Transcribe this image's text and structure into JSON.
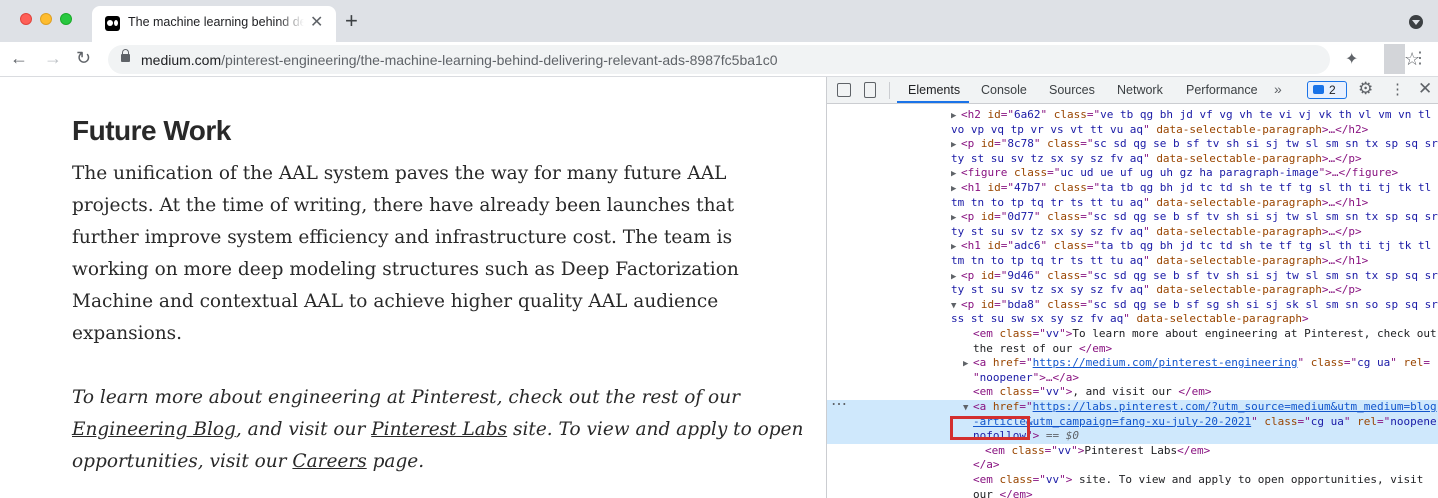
{
  "browser": {
    "tab_title": "The machine learning behind delivering relevant ads",
    "tab_close": "✕",
    "new_tab": "+",
    "url_domain": "medium.com",
    "url_path": "/pinterest-engineering/the-machine-learning-behind-delivering-relevant-ads-8987fc5ba1c0",
    "icons": [
      "back-icon",
      "forward-icon",
      "reload-icon",
      "lock-icon",
      "star-icon",
      "extensions-icon",
      "menu-icon"
    ]
  },
  "article": {
    "heading": "Future Work",
    "paragraph_lines": [
      "The unification of the AAL system paves the way for many future AAL",
      "projects. At the time of writing, there have already been launches that",
      "further improve system efficiency and infrastructure cost. The team is",
      "working on more deep modeling structures such as Deep Factorization",
      "Machine and contextual AAL to achieve higher quality AAL audience",
      "expansions."
    ],
    "italic": {
      "part1": "To learn more about engineering at Pinterest, check out the rest of our",
      "link1": "Engineering Blog",
      "part2": ", and visit our ",
      "link2": "Pinterest Labs",
      "part3": " site. To view and apply to open",
      "part4": "opportunities, visit our ",
      "link3": "Careers",
      "part5": " page."
    }
  },
  "devtools": {
    "tabs": [
      "Elements",
      "Console",
      "Sources",
      "Network",
      "Performance"
    ],
    "active_tab": "Elements",
    "more": "»",
    "badge_count": "2",
    "accent": "#1a73e8",
    "lines": [
      {
        "indent": 1,
        "tri": "▶",
        "parts": [
          [
            "tag",
            "<h2 "
          ],
          [
            "attr",
            "id"
          ],
          [
            "tag",
            "=\""
          ],
          [
            "val",
            "6a62"
          ],
          [
            "tag",
            "\" "
          ],
          [
            "attr",
            "class"
          ],
          [
            "tag",
            "=\""
          ],
          [
            "val",
            "ve tb qg bh jd vf vg vh te vi vj vk th vl vm vn tl"
          ]
        ]
      },
      {
        "indent": 0,
        "tri": "",
        "parts": [
          [
            "val",
            "vo vp vq tp vr vs vt tt vu aq"
          ],
          [
            "tag",
            "\" "
          ],
          [
            "attr",
            "data-selectable-paragraph"
          ],
          [
            "tag",
            ">…</h2>"
          ]
        ]
      },
      {
        "indent": 1,
        "tri": "▶",
        "parts": [
          [
            "tag",
            "<p "
          ],
          [
            "attr",
            "id"
          ],
          [
            "tag",
            "=\""
          ],
          [
            "val",
            "8c78"
          ],
          [
            "tag",
            "\" "
          ],
          [
            "attr",
            "class"
          ],
          [
            "tag",
            "=\""
          ],
          [
            "val",
            "sc sd qg se b sf tv sh si sj tw sl sm sn tx sp sq sr"
          ]
        ]
      },
      {
        "indent": 0,
        "tri": "",
        "parts": [
          [
            "val",
            "ty st su sv tz sx sy sz fv aq"
          ],
          [
            "tag",
            "\" "
          ],
          [
            "attr",
            "data-selectable-paragraph"
          ],
          [
            "tag",
            ">…</p>"
          ]
        ]
      },
      {
        "indent": 1,
        "tri": "▶",
        "parts": [
          [
            "tag",
            "<figure "
          ],
          [
            "attr",
            "class"
          ],
          [
            "tag",
            "=\""
          ],
          [
            "val",
            "uc ud ue uf ug uh gz ha paragraph-image"
          ],
          [
            "tag",
            "\">…</figure>"
          ]
        ]
      },
      {
        "indent": 1,
        "tri": "▶",
        "parts": [
          [
            "tag",
            "<h1 "
          ],
          [
            "attr",
            "id"
          ],
          [
            "tag",
            "=\""
          ],
          [
            "val",
            "47b7"
          ],
          [
            "tag",
            "\" "
          ],
          [
            "attr",
            "class"
          ],
          [
            "tag",
            "=\""
          ],
          [
            "val",
            "ta tb qg bh jd tc td sh te tf tg sl th ti tj tk tl"
          ]
        ]
      },
      {
        "indent": 0,
        "tri": "",
        "parts": [
          [
            "val",
            "tm tn to tp tq tr ts tt tu aq"
          ],
          [
            "tag",
            "\" "
          ],
          [
            "attr",
            "data-selectable-paragraph"
          ],
          [
            "tag",
            ">…</h1>"
          ]
        ]
      },
      {
        "indent": 1,
        "tri": "▶",
        "parts": [
          [
            "tag",
            "<p "
          ],
          [
            "attr",
            "id"
          ],
          [
            "tag",
            "=\""
          ],
          [
            "val",
            "0d77"
          ],
          [
            "tag",
            "\" "
          ],
          [
            "attr",
            "class"
          ],
          [
            "tag",
            "=\""
          ],
          [
            "val",
            "sc sd qg se b sf tv sh si sj tw sl sm sn tx sp sq sr"
          ]
        ]
      },
      {
        "indent": 0,
        "tri": "",
        "parts": [
          [
            "val",
            "ty st su sv tz sx sy sz fv aq"
          ],
          [
            "tag",
            "\" "
          ],
          [
            "attr",
            "data-selectable-paragraph"
          ],
          [
            "tag",
            ">…</p>"
          ]
        ]
      },
      {
        "indent": 1,
        "tri": "▶",
        "parts": [
          [
            "tag",
            "<h1 "
          ],
          [
            "attr",
            "id"
          ],
          [
            "tag",
            "=\""
          ],
          [
            "val",
            "adc6"
          ],
          [
            "tag",
            "\" "
          ],
          [
            "attr",
            "class"
          ],
          [
            "tag",
            "=\""
          ],
          [
            "val",
            "ta tb qg bh jd tc td sh te tf tg sl th ti tj tk tl"
          ]
        ]
      },
      {
        "indent": 0,
        "tri": "",
        "parts": [
          [
            "val",
            "tm tn to tp tq tr ts tt tu aq"
          ],
          [
            "tag",
            "\" "
          ],
          [
            "attr",
            "data-selectable-paragraph"
          ],
          [
            "tag",
            ">…</h1>"
          ]
        ]
      },
      {
        "indent": 1,
        "tri": "▶",
        "parts": [
          [
            "tag",
            "<p "
          ],
          [
            "attr",
            "id"
          ],
          [
            "tag",
            "=\""
          ],
          [
            "val",
            "9d46"
          ],
          [
            "tag",
            "\" "
          ],
          [
            "attr",
            "class"
          ],
          [
            "tag",
            "=\""
          ],
          [
            "val",
            "sc sd qg se b sf tv sh si sj tw sl sm sn tx sp sq sr"
          ]
        ]
      },
      {
        "indent": 0,
        "tri": "",
        "parts": [
          [
            "val",
            "ty st su sv tz sx sy sz fv aq"
          ],
          [
            "tag",
            "\" "
          ],
          [
            "attr",
            "data-selectable-paragraph"
          ],
          [
            "tag",
            ">…</p>"
          ]
        ]
      },
      {
        "indent": 1,
        "tri": "▼",
        "parts": [
          [
            "tag",
            "<p "
          ],
          [
            "attr",
            "id"
          ],
          [
            "tag",
            "=\""
          ],
          [
            "val",
            "bda8"
          ],
          [
            "tag",
            "\" "
          ],
          [
            "attr",
            "class"
          ],
          [
            "tag",
            "=\""
          ],
          [
            "val",
            "sc sd qg se b sf sg sh si sj sk sl sm sn so sp sq sr"
          ]
        ]
      },
      {
        "indent": 0,
        "tri": "",
        "parts": [
          [
            "val",
            "ss st su sw sx sy sz fv aq"
          ],
          [
            "tag",
            "\" "
          ],
          [
            "attr",
            "data-selectable-paragraph"
          ],
          [
            "tag",
            ">"
          ]
        ]
      },
      {
        "indent": 2,
        "tri": "",
        "parts": [
          [
            "tag",
            "<em "
          ],
          [
            "attr",
            "class"
          ],
          [
            "tag",
            "=\""
          ],
          [
            "val",
            "vv"
          ],
          [
            "tag",
            "\">"
          ],
          [
            "txt",
            "To learn more about engineering at Pinterest, check out"
          ]
        ]
      },
      {
        "indent": 2,
        "tri": "",
        "parts": [
          [
            "txt",
            "the rest of our "
          ],
          [
            "tag",
            "</em>"
          ]
        ]
      },
      {
        "indent": 3,
        "tri": "▶",
        "parts": [
          [
            "tag",
            "<a "
          ],
          [
            "attr",
            "href"
          ],
          [
            "tag",
            "=\""
          ],
          [
            "link",
            "https://medium.com/pinterest-engineering"
          ],
          [
            "tag",
            "\" "
          ],
          [
            "attr",
            "class"
          ],
          [
            "tag",
            "=\""
          ],
          [
            "val",
            "cg ua"
          ],
          [
            "tag",
            "\" "
          ],
          [
            "attr",
            "rel"
          ],
          [
            "tag",
            "="
          ]
        ]
      },
      {
        "indent": 2,
        "tri": "",
        "parts": [
          [
            "tag",
            "\""
          ],
          [
            "val",
            "noopener"
          ],
          [
            "tag",
            "\">…</a>"
          ]
        ]
      },
      {
        "indent": 2,
        "tri": "",
        "parts": [
          [
            "tag",
            "<em "
          ],
          [
            "attr",
            "class"
          ],
          [
            "tag",
            "=\""
          ],
          [
            "val",
            "vv"
          ],
          [
            "tag",
            "\">"
          ],
          [
            "txt",
            ", and visit our "
          ],
          [
            "tag",
            "</em>"
          ]
        ]
      },
      {
        "indent": 3,
        "tri": "▼",
        "sel": true,
        "parts": [
          [
            "tag",
            "<a "
          ],
          [
            "attr",
            "href"
          ],
          [
            "tag",
            "=\""
          ],
          [
            "link",
            "https://labs.pinterest.com/?utm_source=medium&utm_medium=blog"
          ]
        ]
      },
      {
        "indent": 2,
        "tri": "",
        "sel": true,
        "parts": [
          [
            "link",
            "-article&utm_campaign=fang-xu-july-20-2021"
          ],
          [
            "tag",
            "\" "
          ],
          [
            "attr",
            "class"
          ],
          [
            "tag",
            "=\""
          ],
          [
            "val",
            "cg ua"
          ],
          [
            "tag",
            "\" "
          ],
          [
            "attr",
            "rel"
          ],
          [
            "tag",
            "=\""
          ],
          [
            "val",
            "noopener"
          ]
        ]
      },
      {
        "indent": 2,
        "tri": "",
        "sel": true,
        "parts": [
          [
            "val",
            "nofollow"
          ],
          [
            "tag",
            "\">"
          ],
          [
            "eq0",
            " == $0"
          ]
        ]
      },
      {
        "indent": 4,
        "tri": "",
        "parts": [
          [
            "tag",
            "<em "
          ],
          [
            "attr",
            "class"
          ],
          [
            "tag",
            "=\""
          ],
          [
            "val",
            "vv"
          ],
          [
            "tag",
            "\">"
          ],
          [
            "txt",
            "Pinterest Labs"
          ],
          [
            "tag",
            "</em>"
          ]
        ]
      },
      {
        "indent": 2,
        "tri": "",
        "parts": [
          [
            "tag",
            "</a>"
          ]
        ]
      },
      {
        "indent": 2,
        "tri": "",
        "parts": [
          [
            "tag",
            "<em "
          ],
          [
            "attr",
            "class"
          ],
          [
            "tag",
            "=\""
          ],
          [
            "val",
            "vv"
          ],
          [
            "tag",
            "\">"
          ],
          [
            "txt",
            " site. To view and apply to open opportunities, visit"
          ]
        ]
      },
      {
        "indent": 2,
        "tri": "",
        "parts": [
          [
            "txt",
            "our "
          ],
          [
            "tag",
            "</em>"
          ]
        ]
      }
    ]
  }
}
